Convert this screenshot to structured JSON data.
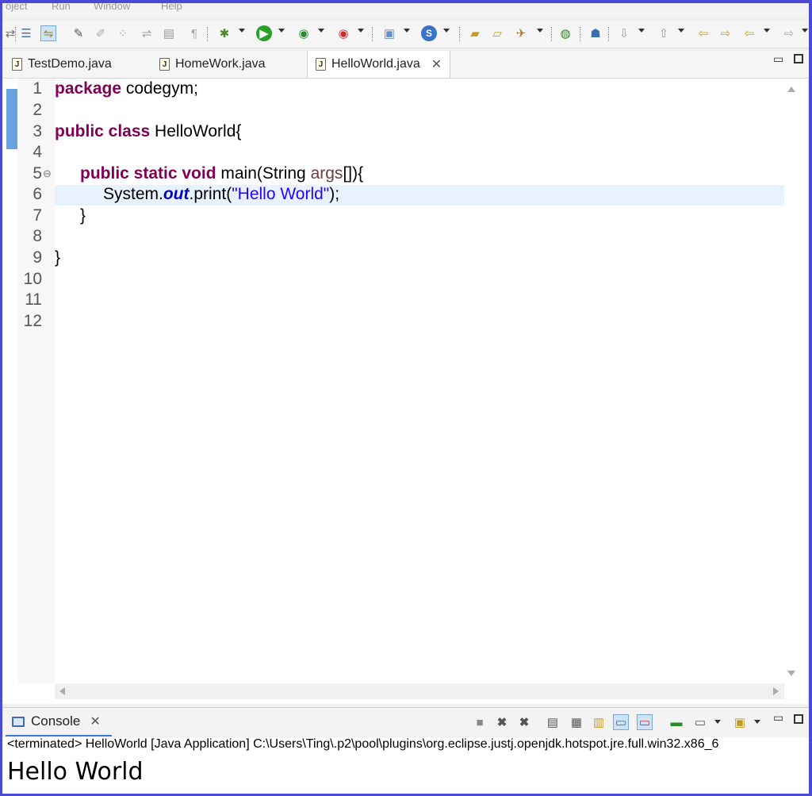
{
  "menu": [
    "oject",
    "Run",
    "Window",
    "Help"
  ],
  "tabs": [
    {
      "label": "TestDemo.java",
      "active": false
    },
    {
      "label": "HomeWork.java",
      "active": false
    },
    {
      "label": "HelloWorld.java",
      "active": true
    }
  ],
  "tab_close_glyph": "✕",
  "editor": {
    "line_numbers": [
      "1",
      "2",
      "3",
      "4",
      "5",
      "6",
      "7",
      "8",
      "9",
      "10",
      "11",
      "12"
    ],
    "fold_marker": "⊖",
    "code": {
      "l1_kw": "package",
      "l1_rest": " codegym;",
      "l3_kw": "public class",
      "l3_rest": " HelloWorld{",
      "l5_kw": "public static void",
      "l5_rest1": " main(String ",
      "l5_arg": "args",
      "l5_rest2": "[]){",
      "l6_a": "System.",
      "l6_field": "out",
      "l6_b": ".print(",
      "l6_str": "\"Hello World\"",
      "l6_c": ");",
      "l7": "}",
      "l9": "}"
    }
  },
  "console": {
    "tab_label": "Console",
    "status": "<terminated> HelloWorld [Java Application] C:\\Users\\Ting\\.p2\\pool\\plugins\\org.eclipse.justj.openjdk.hotspot.jre.full.win32.x86_6",
    "output": "Hello World"
  },
  "colors": {
    "keyword": "#7f0055",
    "string": "#2a00ff",
    "field": "#0000c0",
    "highlight": "#e8f2fe",
    "accent": "#3b7dd8"
  }
}
